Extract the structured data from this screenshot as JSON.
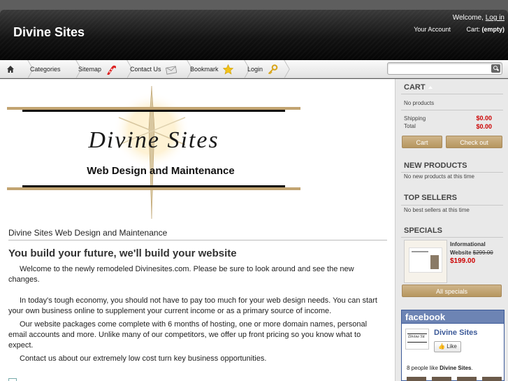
{
  "header": {
    "site_title": "Divine Sites",
    "welcome_text": "Welcome,",
    "login_link": "Log in",
    "your_account": "Your Account",
    "cart_label": "Cart:",
    "cart_status": "(empty)"
  },
  "nav": {
    "items": [
      {
        "label": "Categories",
        "icon": "none"
      },
      {
        "label": "Sitemap",
        "icon": "candy-cane-icon"
      },
      {
        "label": "Contact Us",
        "icon": "envelope-icon"
      },
      {
        "label": "Bookmark",
        "icon": "star-icon"
      },
      {
        "label": "Login",
        "icon": "key-icon"
      }
    ],
    "search_placeholder": ""
  },
  "main": {
    "logo_title": "Divine Sites",
    "logo_subtitle": "Web Design and Maintenance",
    "page_title": "Divine Sites Web Design and Maintenance",
    "headline": "You build your future, we'll build your website",
    "paragraphs": [
      "Welcome to the newly remodeled Divinesites.com.  Please be sure to look around and see the new changes.",
      "In today's tough economy, you should not have to pay too much for your web design needs. You can start your own business online to supplement your current income or as a primary source of income.",
      "Our website packages come complete with 6 months of hosting, one or more domain names, personal email accounts and more.  Unlike many of our competitors, we offer up front pricing so you know what to expect.",
      "Contact us about our extremely low cost turn key business opportunities."
    ]
  },
  "sidebar": {
    "cart": {
      "heading": "CART",
      "empty_text": "No products",
      "shipping_label": "Shipping",
      "shipping_value": "$0.00",
      "total_label": "Total",
      "total_value": "$0.00",
      "cart_button": "Cart",
      "checkout_button": "Check out"
    },
    "new_products": {
      "heading": "NEW PRODUCTS",
      "text": "No new products at this time"
    },
    "top_sellers": {
      "heading": "TOP SELLERS",
      "text": "No best sellers at this time"
    },
    "specials": {
      "heading": "SPECIALS",
      "product_name": "Informational Website",
      "old_price": "$299.00",
      "new_price": "$199.00",
      "all_button": "All specials"
    },
    "facebook": {
      "brand": "facebook",
      "page_name": "Divine Sites",
      "like_label": "Like",
      "count_prefix": "8 people like",
      "count_name": "Divine Sites",
      "count_suffix": "."
    }
  },
  "colors": {
    "accent_gold": "#c2a471",
    "price_red": "#cc0000",
    "facebook_blue": "#3b5998"
  }
}
